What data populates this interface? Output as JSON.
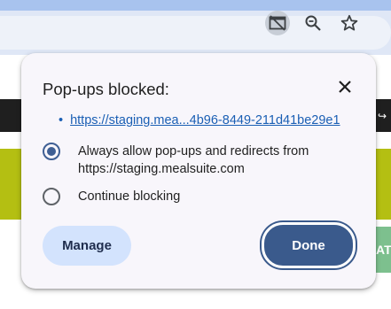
{
  "popup": {
    "title": "Pop-ups blocked:",
    "blocked_link": "https://staging.mea...4b96-8449-211d41be29e1",
    "link_bullet": "•",
    "options": [
      {
        "label": "Always allow pop-ups and redirects from https://staging.mealsuite.com",
        "checked": true
      },
      {
        "label": "Continue blocking",
        "checked": false
      }
    ],
    "manage_label": "Manage",
    "done_label": "Done"
  },
  "page": {
    "partial_button_text": "AT"
  },
  "icons": {
    "popup_blocked": "popup-blocked-icon",
    "zoom": "zoom-icon",
    "bookmark": "star-icon",
    "close": "close-icon"
  },
  "colors": {
    "accent": "#3a5a8c",
    "link": "#1a5fb4",
    "manage_bg": "#d3e3fd"
  }
}
